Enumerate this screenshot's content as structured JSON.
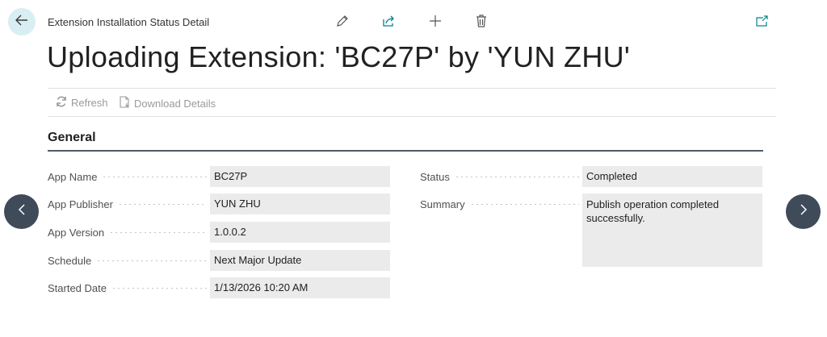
{
  "header": {
    "page_caption": "Extension Installation Status Detail",
    "title": "Uploading Extension: 'BC27P' by 'YUN ZHU'",
    "icons": {
      "back": "arrow-left-icon",
      "edit": "pencil-icon",
      "share": "share-icon",
      "new": "plus-icon",
      "delete": "trash-icon",
      "popout": "open-in-new-window-icon"
    }
  },
  "actions": {
    "refresh": "Refresh",
    "download_details": "Download Details"
  },
  "section": {
    "title": "General"
  },
  "fields_left": [
    {
      "label": "App Name",
      "value": "BC27P"
    },
    {
      "label": "App Publisher",
      "value": "YUN ZHU"
    },
    {
      "label": "App Version",
      "value": "1.0.0.2"
    },
    {
      "label": "Schedule",
      "value": "Next Major Update"
    },
    {
      "label": "Started Date",
      "value": "1/13/2026 10:20 AM"
    }
  ],
  "fields_right": [
    {
      "label": "Status",
      "value": "Completed"
    },
    {
      "label": "Summary",
      "value": "Publish operation completed successfully."
    }
  ],
  "colors": {
    "accent": "#00838f",
    "nav_button": "#3f4b59",
    "field_bg": "#ebebeb",
    "back_button_bg": "#d8eef2"
  }
}
